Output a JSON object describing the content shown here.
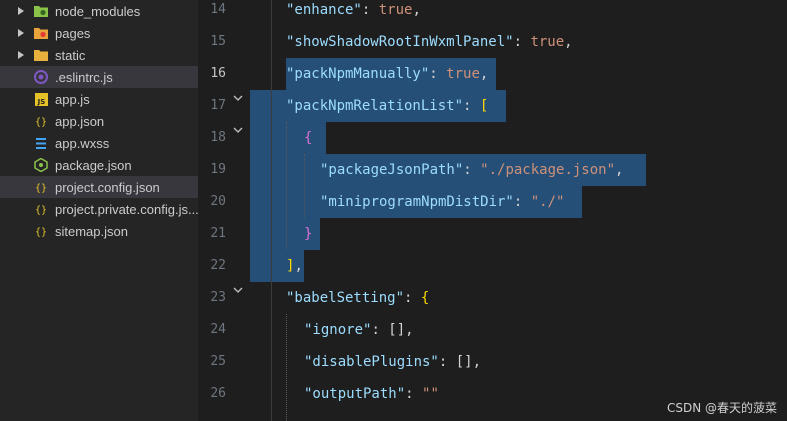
{
  "explorer": {
    "items": [
      {
        "label": "node_modules",
        "icon": "folder-node-icon",
        "type": "folder"
      },
      {
        "label": "pages",
        "icon": "folder-pages-icon",
        "type": "folder"
      },
      {
        "label": "static",
        "icon": "folder-icon",
        "type": "folder"
      },
      {
        "label": ".eslintrc.js",
        "icon": "eslint-icon",
        "type": "file"
      },
      {
        "label": "app.js",
        "icon": "js-icon",
        "type": "file"
      },
      {
        "label": "app.json",
        "icon": "json-icon",
        "type": "file"
      },
      {
        "label": "app.wxss",
        "icon": "css-icon",
        "type": "file"
      },
      {
        "label": "package.json",
        "icon": "node-icon",
        "type": "file"
      },
      {
        "label": "project.config.json",
        "icon": "json-icon",
        "type": "file"
      },
      {
        "label": "project.private.config.js...",
        "icon": "json-icon",
        "type": "file"
      },
      {
        "label": "sitemap.json",
        "icon": "json-icon",
        "type": "file"
      }
    ]
  },
  "editor": {
    "line_numbers": [
      "14",
      "15",
      "16",
      "17",
      "18",
      "19",
      "20",
      "21",
      "22",
      "23",
      "24",
      "25",
      "26"
    ],
    "active_line": "16",
    "code": {
      "l14": {
        "key": "\"enhance\"",
        "colon": ": ",
        "val": "true",
        "end": ","
      },
      "l15": {
        "key": "\"showShadowRootInWxmlPanel\"",
        "colon": ": ",
        "val": "true",
        "end": ","
      },
      "l16": {
        "key": "\"packNpmManually\"",
        "colon": ": ",
        "val": "true",
        "end": ","
      },
      "l17": {
        "key": "\"packNpmRelationList\"",
        "colon": ": ",
        "open": "["
      },
      "l18": {
        "open": "{"
      },
      "l19": {
        "key": "\"packageJsonPath\"",
        "colon": ": ",
        "val": "\"./package.json\"",
        "end": ","
      },
      "l20": {
        "key": "\"miniprogramNpmDistDir\"",
        "colon": ": ",
        "val": "\"./\""
      },
      "l21": {
        "close": "}"
      },
      "l22": {
        "close": "]",
        "end": ","
      },
      "l23": {
        "key": "\"babelSetting\"",
        "colon": ": ",
        "open": "{"
      },
      "l24": {
        "key": "\"ignore\"",
        "colon": ": ",
        "val": "[]",
        "end": ","
      },
      "l25": {
        "key": "\"disablePlugins\"",
        "colon": ": ",
        "val": "[]",
        "end": ","
      },
      "l26": {
        "key": "\"outputPath\"",
        "colon": ": ",
        "val": "\"\""
      }
    }
  },
  "watermark": "CSDN @春天的菠菜",
  "colors": {
    "sidebar_bg": "#252526",
    "editor_bg": "#1e1e1e",
    "selection": "#264f78",
    "key": "#9cdcfe",
    "string": "#ce9178"
  }
}
